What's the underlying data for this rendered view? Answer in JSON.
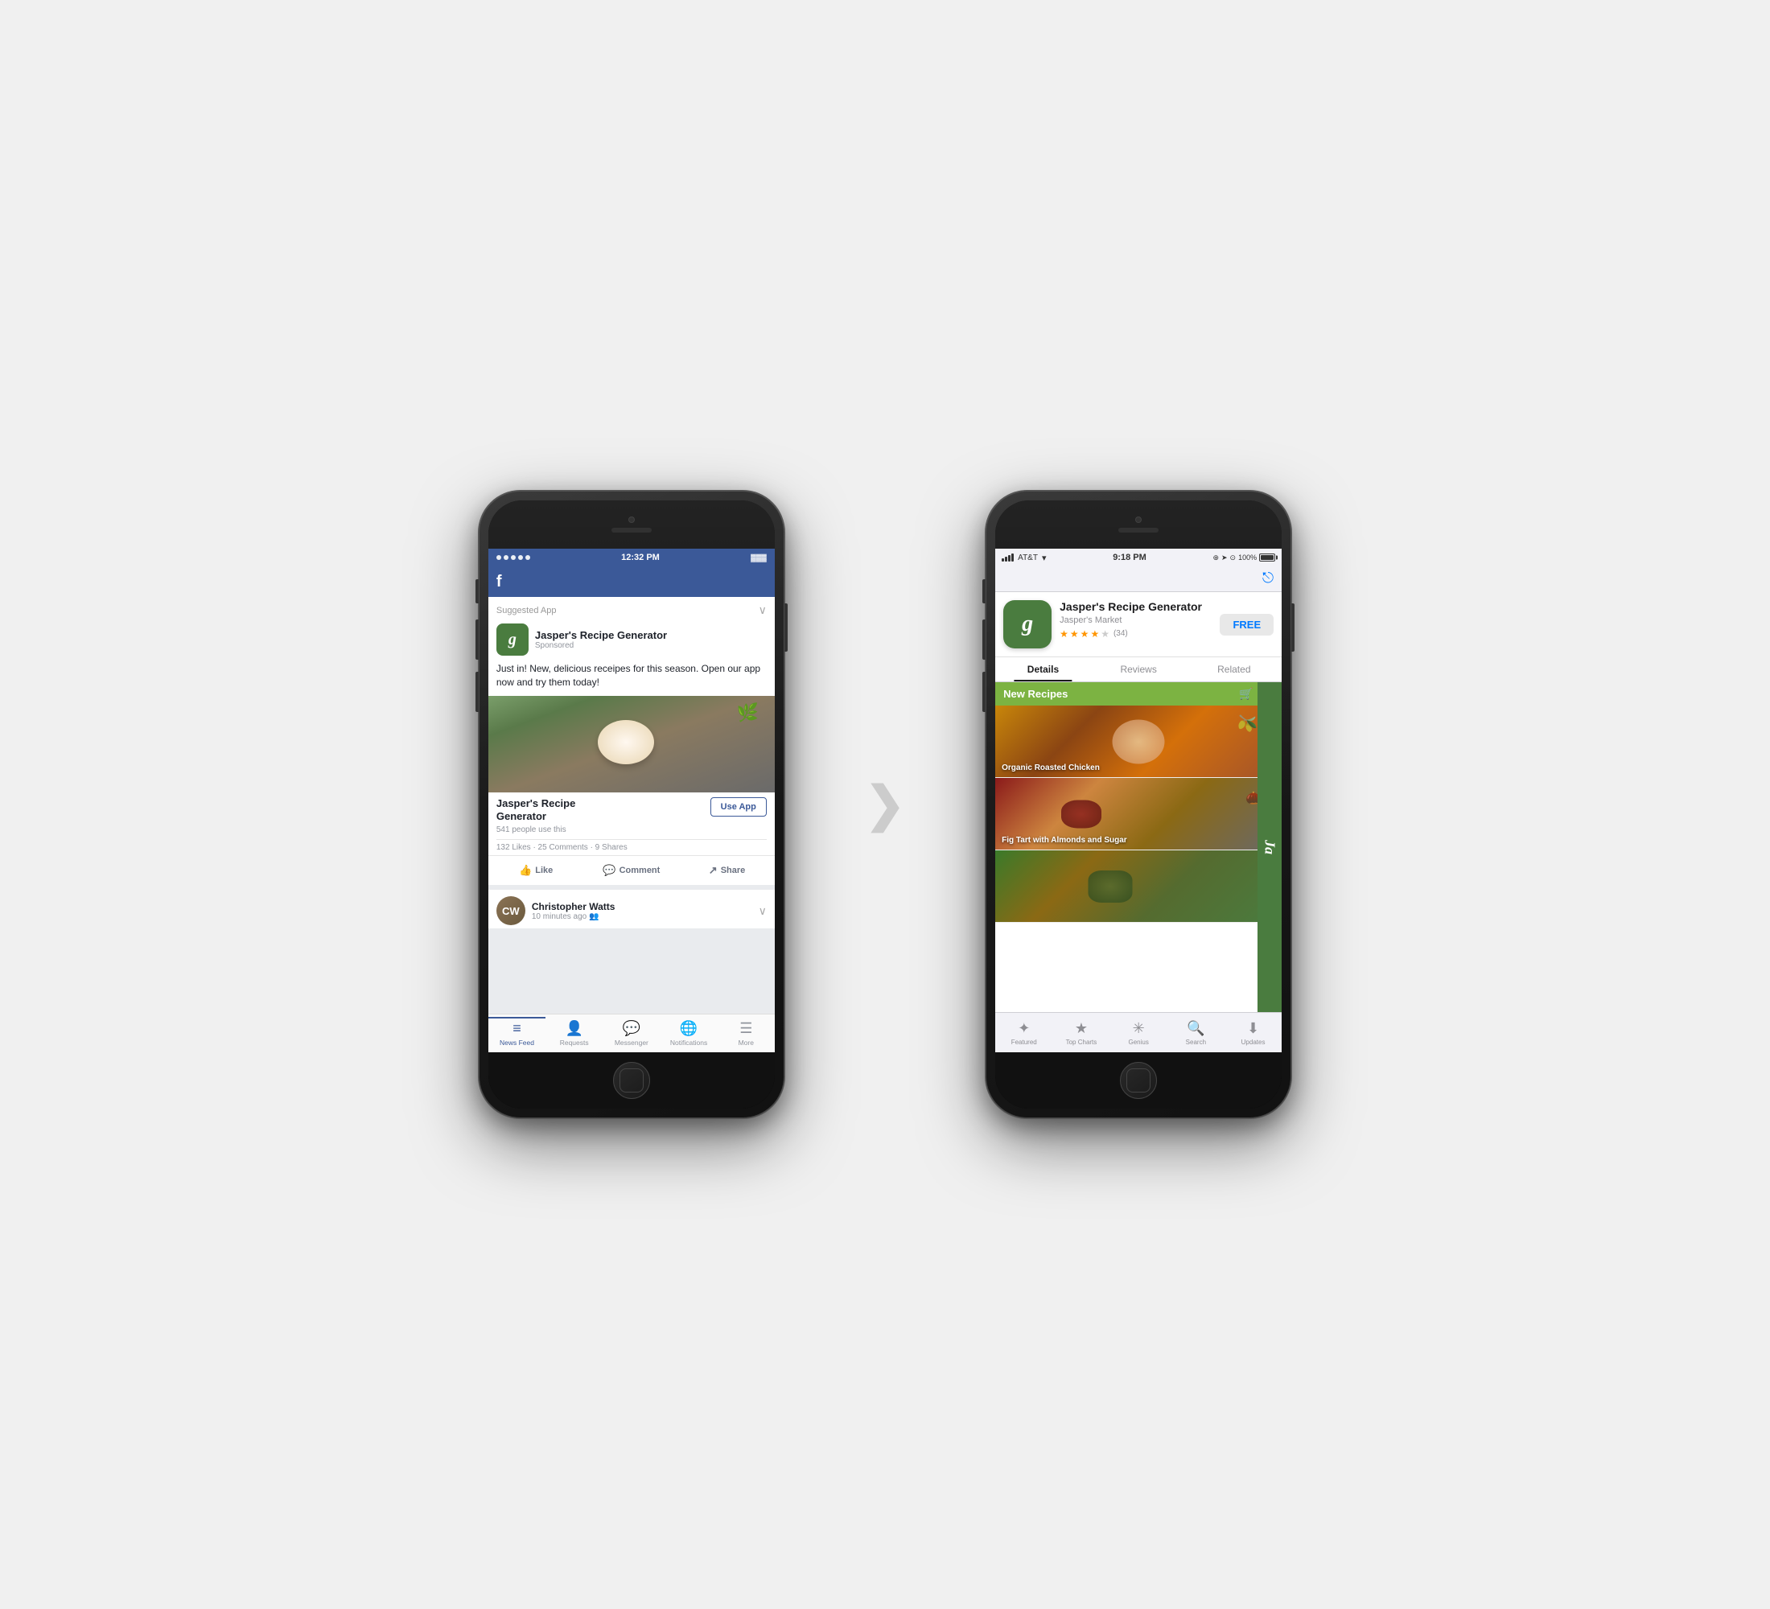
{
  "background_color": "#f0f0f0",
  "arrow": "❯",
  "phone_left": {
    "status_bar": {
      "dots": 5,
      "time": "12:32 PM",
      "battery": "▓▓▓"
    },
    "suggested_app_label": "Suggested App",
    "app_icon_letter": "g",
    "app_name": "Jasper's Recipe Generator",
    "app_sponsored": "Sponsored",
    "ad_text": "Just in! New, delicious receipes for this season. Open our app now and try them today!",
    "cta_app_name_line1": "Jasper's Recipe",
    "cta_app_name_line2": "Generator",
    "use_app_label": "Use App",
    "users_text": "541 people use this",
    "stats_text": "132 Likes · 25 Comments · 9 Shares",
    "action_like": "Like",
    "action_comment": "Comment",
    "action_share": "Share",
    "post_user": "Christopher Watts",
    "post_time": "10 minutes ago",
    "tab_bar": {
      "items": [
        {
          "label": "News Feed",
          "active": true
        },
        {
          "label": "Requests",
          "active": false
        },
        {
          "label": "Messenger",
          "active": false
        },
        {
          "label": "Notifications",
          "active": false
        },
        {
          "label": "More",
          "active": false
        }
      ]
    }
  },
  "phone_right": {
    "status_bar": {
      "carrier": "AT&T",
      "wifi": "wifi",
      "time": "9:18 PM",
      "icons": "⊕ ➤ ⊙",
      "battery_percent": "100%"
    },
    "app_icon_letter": "g",
    "app_name": "Jasper's Recipe Generator",
    "app_maker": "Jasper's Market",
    "stars": 3.5,
    "review_count": "(34)",
    "free_label": "FREE",
    "tabs": [
      {
        "label": "Details",
        "active": true
      },
      {
        "label": "Reviews",
        "active": false
      },
      {
        "label": "Related",
        "active": false
      }
    ],
    "section_title": "New Recipes",
    "recipes": [
      {
        "name": "Organic Roasted Chicken"
      },
      {
        "name": "Fig Tart with Almonds and Sugar"
      },
      {
        "name": ""
      }
    ],
    "side_letter": "Ja",
    "tab_bar": {
      "items": [
        {
          "label": "Featured",
          "active": false
        },
        {
          "label": "Top Charts",
          "active": false
        },
        {
          "label": "Genius",
          "active": false
        },
        {
          "label": "Search",
          "active": false
        },
        {
          "label": "Updates",
          "active": false
        }
      ]
    }
  }
}
